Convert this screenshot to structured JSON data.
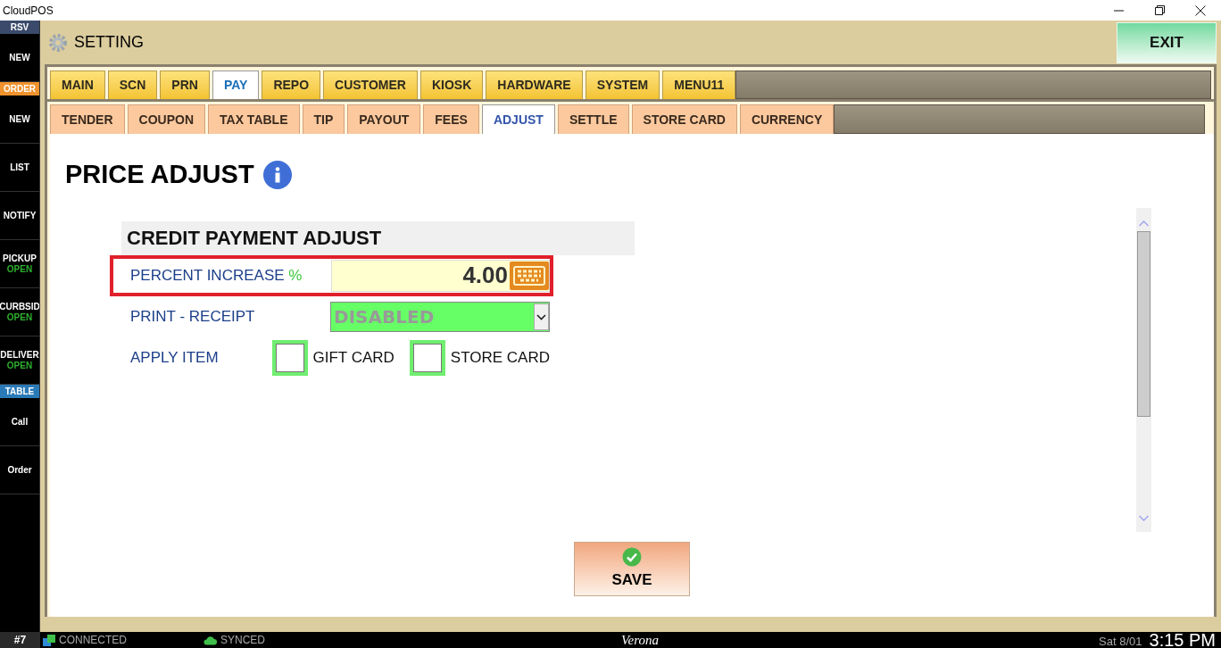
{
  "window": {
    "title": "CloudPOS"
  },
  "sidebar": {
    "items": [
      {
        "kind": "header",
        "label": "RSV",
        "color": "#3b4a6b"
      },
      {
        "kind": "button",
        "label": "NEW"
      },
      {
        "kind": "header",
        "label": "ORDER",
        "color": "#f0922e"
      },
      {
        "kind": "button",
        "label": "NEW"
      },
      {
        "kind": "button",
        "label": "LIST"
      },
      {
        "kind": "button",
        "label": "NOTIFY"
      },
      {
        "kind": "button",
        "label": "PICKUP",
        "status": "OPEN"
      },
      {
        "kind": "button",
        "label": "CURBSID",
        "status": "OPEN"
      },
      {
        "kind": "button",
        "label": "DELIVER",
        "status": "OPEN"
      },
      {
        "kind": "header",
        "label": "TABLE",
        "color": "#2a7ab8"
      },
      {
        "kind": "button",
        "label": "Call"
      },
      {
        "kind": "button",
        "label": "Order"
      }
    ]
  },
  "header": {
    "title": "SETTING",
    "exit_button": "EXIT"
  },
  "tabs": [
    {
      "label": "MAIN",
      "selected": false
    },
    {
      "label": "SCN",
      "selected": false
    },
    {
      "label": "PRN",
      "selected": false
    },
    {
      "label": "PAY",
      "selected": true
    },
    {
      "label": "REPO",
      "selected": false
    },
    {
      "label": "CUSTOMER",
      "selected": false
    },
    {
      "label": "KIOSK",
      "selected": false
    },
    {
      "label": "HARDWARE",
      "selected": false
    },
    {
      "label": "SYSTEM",
      "selected": false
    },
    {
      "label": "MENU11",
      "selected": false
    }
  ],
  "subtabs": [
    {
      "label": "TENDER",
      "selected": false
    },
    {
      "label": "COUPON",
      "selected": false
    },
    {
      "label": "TAX TABLE",
      "selected": false
    },
    {
      "label": "TIP",
      "selected": false
    },
    {
      "label": "PAYOUT",
      "selected": false
    },
    {
      "label": "FEES",
      "selected": false
    },
    {
      "label": "ADJUST",
      "selected": true
    },
    {
      "label": "SETTLE",
      "selected": false
    },
    {
      "label": "STORE CARD",
      "selected": false
    },
    {
      "label": "CURRENCY",
      "selected": false
    }
  ],
  "page": {
    "title": "PRICE ADJUST",
    "section_title": "CREDIT PAYMENT ADJUST",
    "rows": [
      {
        "kind": "number",
        "label": "PERCENT INCREASE",
        "unit": "%",
        "value": "4.00",
        "highlighted": true
      },
      {
        "kind": "select",
        "label": "PRINT - RECEIPT",
        "value": "DISABLED"
      },
      {
        "kind": "checkboxes",
        "label": "APPLY ITEM",
        "options": [
          {
            "label": "GIFT CARD",
            "checked": false
          },
          {
            "label": "STORE CARD",
            "checked": false
          }
        ]
      }
    ],
    "save_button": "SAVE"
  },
  "status_bar": {
    "station": "#7",
    "connection": "CONNECTED",
    "sync": "SYNCED",
    "store": "Verona",
    "date": "Sat 8/01",
    "time": "3:15 PM"
  }
}
